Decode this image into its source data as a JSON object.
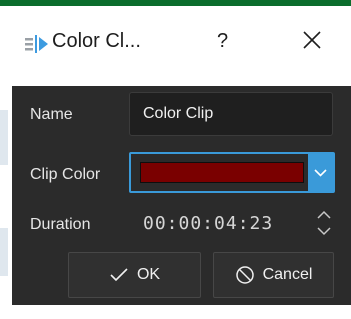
{
  "window": {
    "title": "Color Cl...",
    "help_glyph": "?",
    "close_icon": "close-icon",
    "title_icon": "clip-arrow-icon"
  },
  "form": {
    "name_label": "Name",
    "name_value": "Color Clip",
    "clip_color_label": "Clip Color",
    "clip_color_value": "#7a0000",
    "duration_label": "Duration",
    "duration_value": "00:00:04:23"
  },
  "buttons": {
    "ok_label": "OK",
    "cancel_label": "Cancel",
    "ok_icon": "checkmark-icon",
    "cancel_icon": "cancel-circle-icon"
  },
  "colors": {
    "accent": "#3a9ad9",
    "dialog_bg": "#2b2b2b",
    "title_icon_arrow": "#3d9be0"
  }
}
